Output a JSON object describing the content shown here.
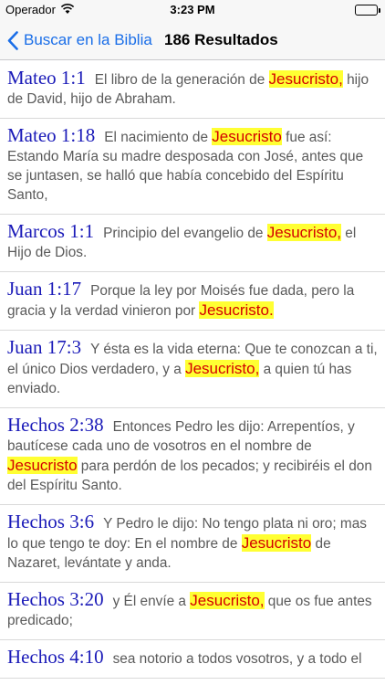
{
  "status_bar": {
    "carrier": "Operador",
    "time": "3:23 PM"
  },
  "nav": {
    "back_label": "Buscar en la Biblia",
    "title": "186 Resultados"
  },
  "results": [
    {
      "reference": "Mateo 1:1",
      "parts": [
        "El libro de la generación de ",
        "Jesucristo,",
        " hijo de David, hijo de Abraham."
      ]
    },
    {
      "reference": "Mateo 1:18",
      "parts": [
        "El nacimiento de ",
        "Jesucristo",
        " fue así: Estando María su madre desposada con José, antes que se juntasen, se halló que había concebido del Espíritu Santo,"
      ]
    },
    {
      "reference": "Marcos 1:1",
      "parts": [
        "Principio del evangelio de ",
        "Jesucristo,",
        " el Hijo de Dios."
      ]
    },
    {
      "reference": "Juan 1:17",
      "parts": [
        "Porque la ley por Moisés fue dada, pero la gracia y la verdad vinieron por ",
        "Jesucristo.",
        ""
      ]
    },
    {
      "reference": "Juan 17:3",
      "parts": [
        "Y ésta es la vida eterna: Que te conozcan a ti, el único Dios verdadero, y a ",
        "Jesucristo,",
        " a quien tú has enviado."
      ]
    },
    {
      "reference": "Hechos 2:38",
      "parts": [
        "Entonces Pedro les dijo: Arrepentíos, y bautícese cada uno de vosotros en el nombre de ",
        "Jesucristo",
        " para perdón de los pecados; y recibiréis el don del Espíritu Santo."
      ]
    },
    {
      "reference": "Hechos 3:6",
      "parts": [
        "Y Pedro le dijo: No tengo plata ni oro; mas lo que tengo te doy: En el nombre de ",
        "Jesucristo",
        " de Nazaret, levántate y anda."
      ]
    },
    {
      "reference": "Hechos 3:20",
      "parts": [
        "y Él envíe a ",
        "Jesucristo,",
        " que os fue antes predicado;"
      ]
    },
    {
      "reference": "Hechos 4:10",
      "parts": [
        "sea notorio a todos vosotros, y a todo el",
        "",
        ""
      ]
    }
  ]
}
